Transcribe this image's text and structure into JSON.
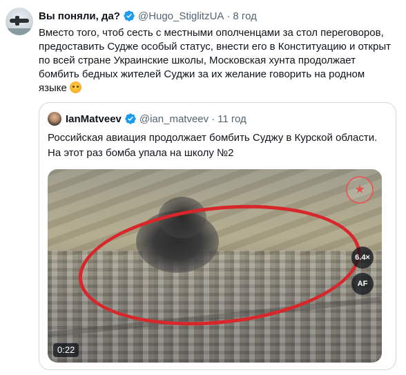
{
  "tweet": {
    "author": {
      "display_name": "Вы поняли, да?",
      "handle": "@Hugo_StiglitzUA",
      "time": "8 год",
      "avatar_icon": "plane-avatar-icon"
    },
    "text_lines": [
      "Вместо того, чтоб сесть с местными  ополченцами за стол переговоров,",
      "предоставить Судже особый статус, внести его в Конституацию и открыт",
      "по всей стране Украинские школы, Московская хунта продолжает",
      "бомбить бедных жителей Суджи за их желание говорить на родном",
      "языке"
    ],
    "emoji": "hugging-face-icon",
    "separator": "·"
  },
  "quote": {
    "author": {
      "display_name": "IanMatveev",
      "handle": "@ian_matveev",
      "time": "11 год"
    },
    "text_lines": [
      "Российская авиация продолжает бомбить Суджу в Курской области.",
      "На этот раз бомба упала на школу №2"
    ],
    "media": {
      "speed_label": "6.4×",
      "af_label": "AF",
      "duration": "0:22"
    }
  },
  "colors": {
    "verified_blue": "#1d9bf0",
    "highlight_ring": "#d8272b",
    "secondary_text": "#536471"
  }
}
